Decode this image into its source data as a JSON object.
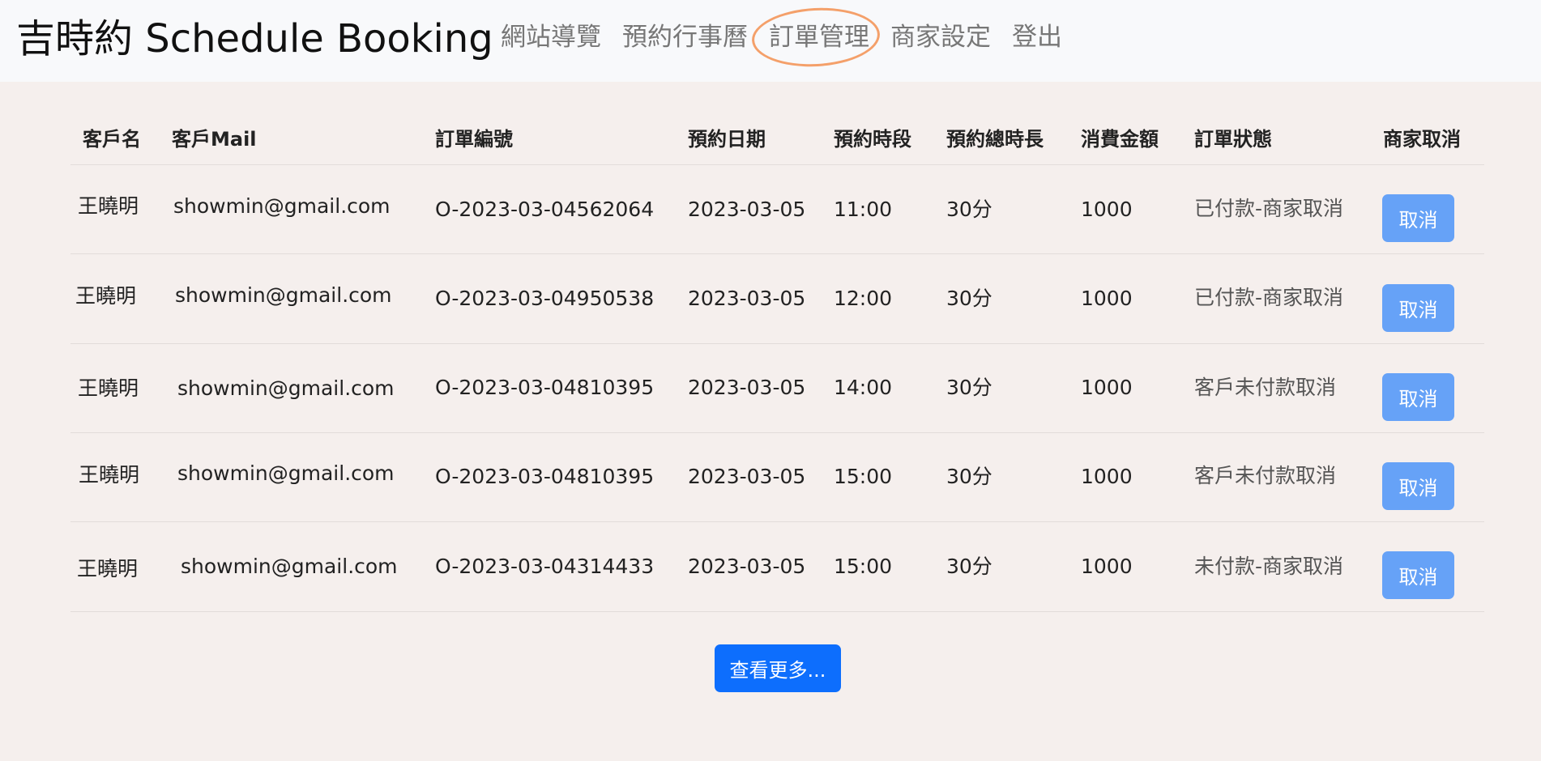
{
  "navbar": {
    "brand": "吉時約 Schedule Booking",
    "links": [
      "網站導覽",
      "預約行事曆",
      "訂單管理",
      "商家設定",
      "登出"
    ],
    "highlight_color": "#f4a06a"
  },
  "table": {
    "headers": [
      "客戶名",
      "客戶Mail",
      "訂單編號",
      "預約日期",
      "預約時段",
      "預約總時長",
      "消費金額",
      "訂單狀態",
      "商家取消"
    ],
    "rows": [
      {
        "name": "王曉明",
        "mail": "showmin@gmail.com",
        "order_id": "O-2023-03-04562064",
        "date": "2023-03-05",
        "time": "11:00",
        "duration": "30分",
        "amount": "1000",
        "status": "已付款-商家取消",
        "action": "取消"
      },
      {
        "name": "王曉明",
        "mail": "showmin@gmail.com",
        "order_id": "O-2023-03-04950538",
        "date": "2023-03-05",
        "time": "12:00",
        "duration": "30分",
        "amount": "1000",
        "status": "已付款-商家取消",
        "action": "取消"
      },
      {
        "name": "王曉明",
        "mail": "showmin@gmail.com",
        "order_id": "O-2023-03-04810395",
        "date": "2023-03-05",
        "time": "14:00",
        "duration": "30分",
        "amount": "1000",
        "status": "客戶未付款取消",
        "action": "取消"
      },
      {
        "name": "王曉明",
        "mail": "showmin@gmail.com",
        "order_id": "O-2023-03-04810395",
        "date": "2023-03-05",
        "time": "15:00",
        "duration": "30分",
        "amount": "1000",
        "status": "客戶未付款取消",
        "action": "取消"
      },
      {
        "name": "王曉明",
        "mail": "showmin@gmail.com",
        "order_id": "O-2023-03-04314433",
        "date": "2023-03-05",
        "time": "15:00",
        "duration": "30分",
        "amount": "1000",
        "status": "未付款-商家取消",
        "action": "取消"
      }
    ]
  },
  "more_button": "查看更多...",
  "colors": {
    "page_bg": "#f5efed",
    "navbar_bg": "#f8f9fb",
    "cancel_button": "#66a2f7",
    "more_button": "#0d6efd"
  }
}
